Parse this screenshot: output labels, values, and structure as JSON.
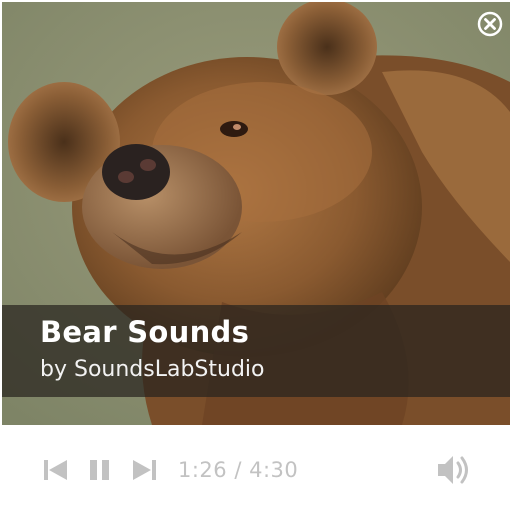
{
  "track": {
    "title": "Bear Sounds",
    "artist": "by SoundsLabStudio"
  },
  "player": {
    "current_time": "1:26",
    "separator": " / ",
    "duration": "4:30",
    "icon_color": "#c2c2c2"
  },
  "icons": {
    "close": "close-icon",
    "previous": "skip-previous-icon",
    "pause": "pause-icon",
    "next": "skip-next-icon",
    "volume": "volume-icon"
  }
}
